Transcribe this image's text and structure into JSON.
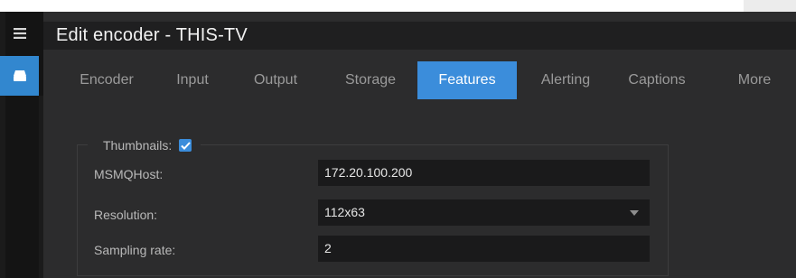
{
  "window": {
    "title": "Edit encoder - THIS-TV"
  },
  "sidebar": {
    "menu_icon": "hamburger-menu-icon",
    "active_item_icon": "encoder-device-icon",
    "accent": "#3287cf"
  },
  "tabs": [
    {
      "label": "Encoder",
      "active": false
    },
    {
      "label": "Input",
      "active": false
    },
    {
      "label": "Output",
      "active": false
    },
    {
      "label": "Storage",
      "active": false
    },
    {
      "label": "Features",
      "active": true
    },
    {
      "label": "Alerting",
      "active": false
    },
    {
      "label": "Captions",
      "active": false
    },
    {
      "label": "More",
      "active": false
    }
  ],
  "thumbnails": {
    "legend_label": "Thumbnails:",
    "enabled": true,
    "fields": {
      "msmq_host": {
        "label": "MSMQHost:",
        "value": "172.20.100.200"
      },
      "resolution": {
        "label": "Resolution:",
        "value": "112x63"
      },
      "sampling_rate": {
        "label": "Sampling rate:",
        "value": "2"
      }
    }
  },
  "colors": {
    "accent": "#3b8ddb",
    "background": "#2c2c2d",
    "title_bar": "#1f1f20",
    "input_bg": "#1a1a1b"
  }
}
